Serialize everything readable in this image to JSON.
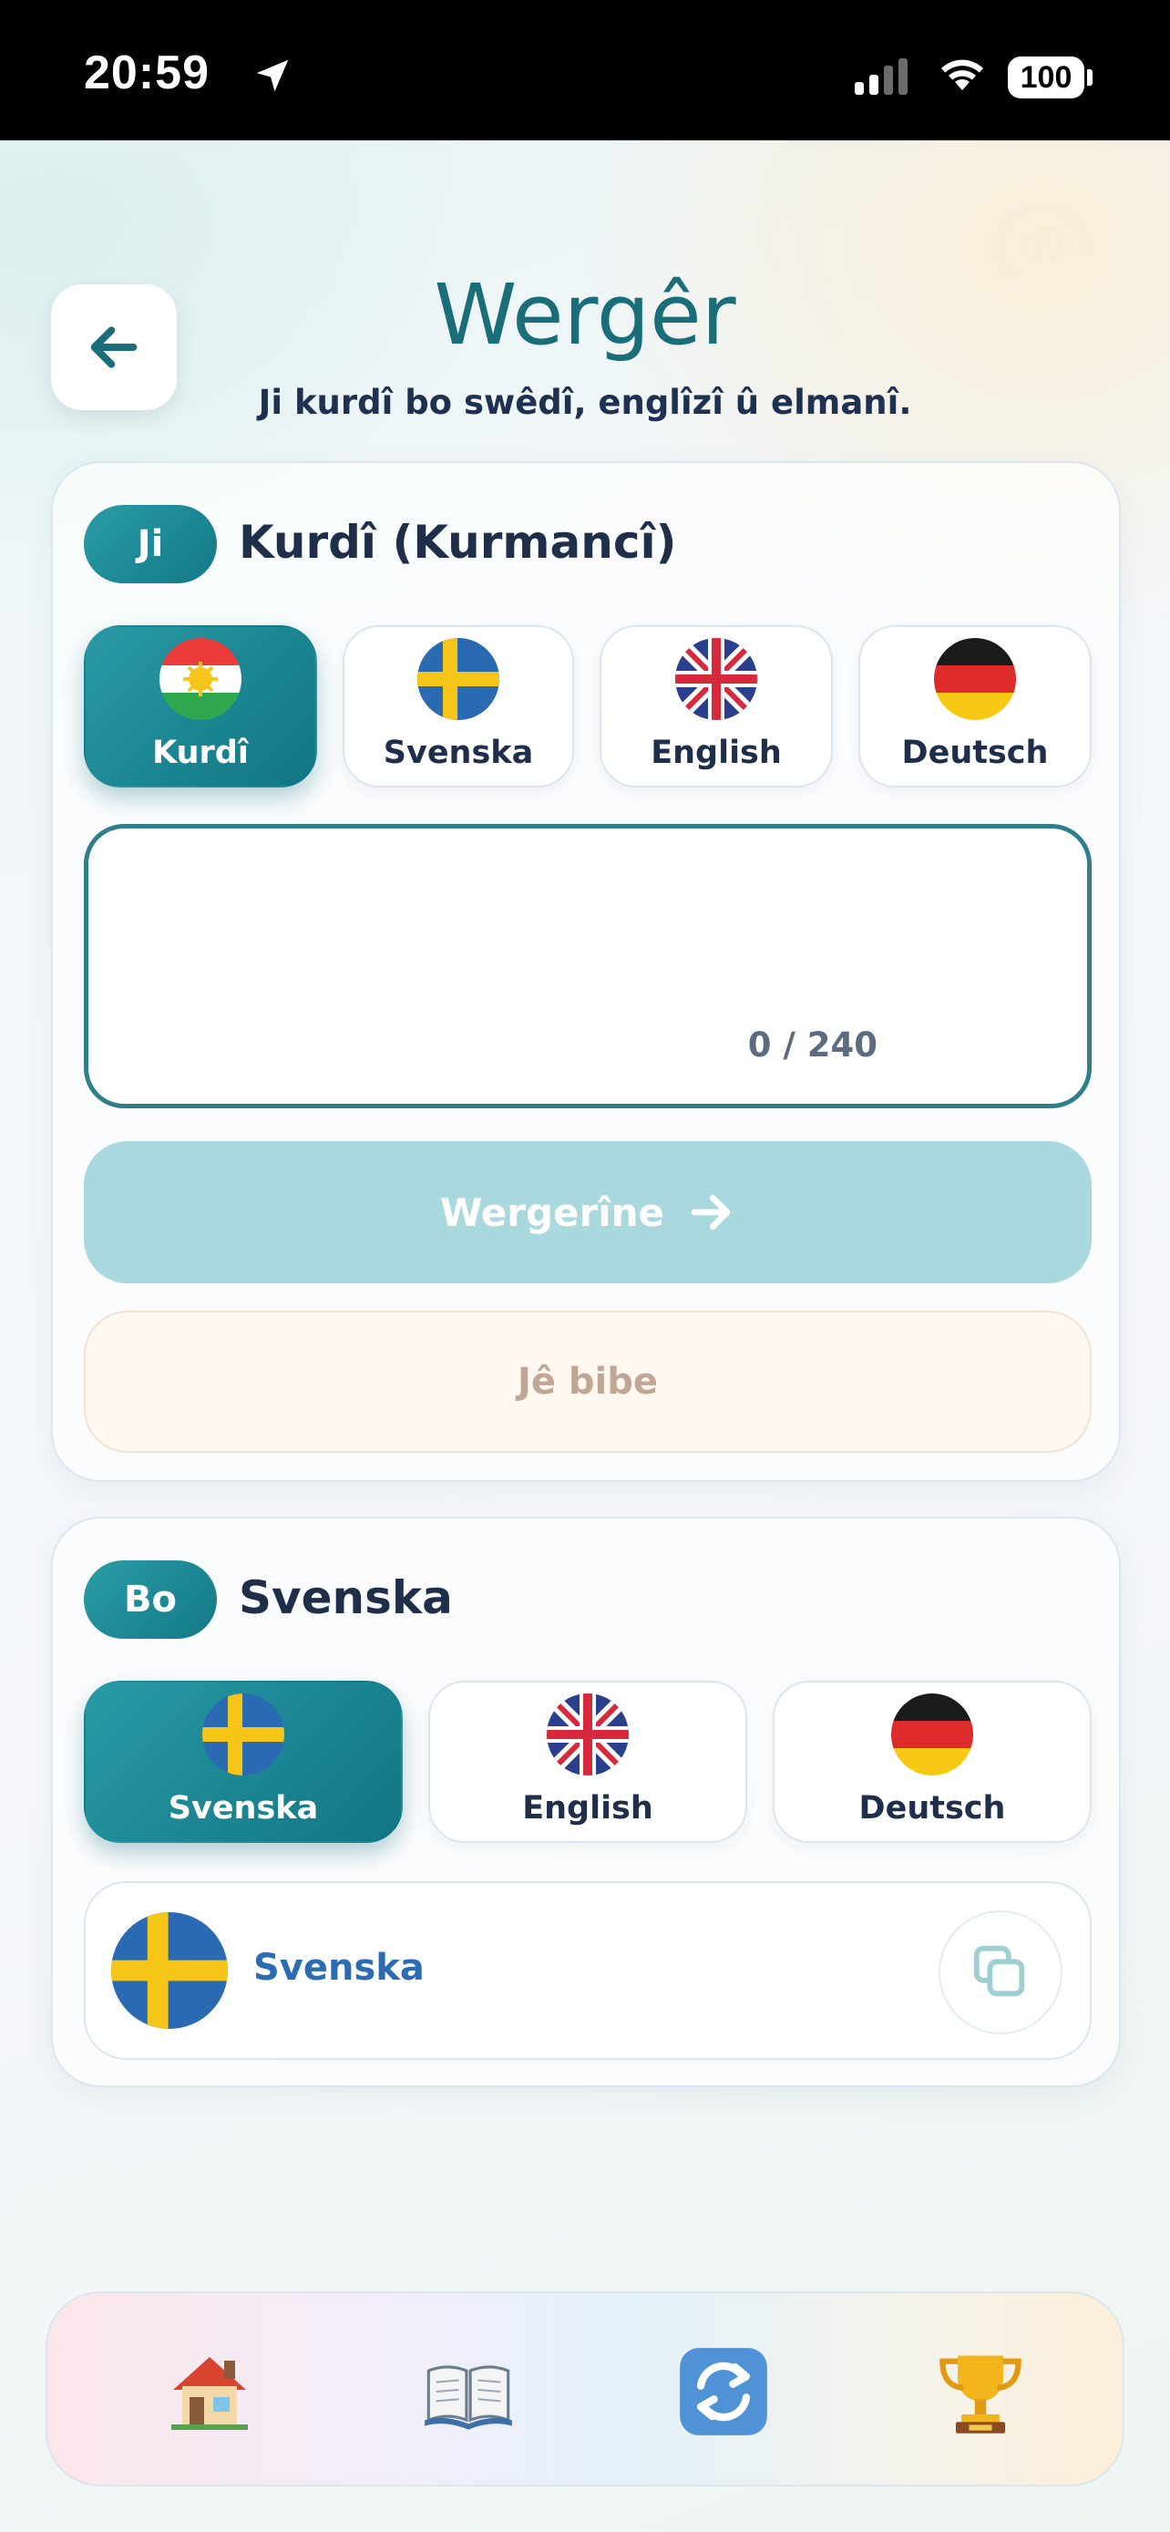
{
  "status_bar": {
    "time": "20:59",
    "battery": "100"
  },
  "header": {
    "title": "Wergêr",
    "subtitle": "Ji kurdî bo swêdî, englîzî û elmanî."
  },
  "source": {
    "pill": "Ji",
    "heading": "Kurdî (Kurmancî)",
    "languages": [
      {
        "label": "Kurdî",
        "flag": "kurdistan-flag",
        "active": true
      },
      {
        "label": "Svenska",
        "flag": "sweden-flag",
        "active": false
      },
      {
        "label": "English",
        "flag": "uk-flag",
        "active": false
      },
      {
        "label": "Deutsch",
        "flag": "germany-flag",
        "active": false
      }
    ],
    "input_value": "",
    "char_count": "0 / 240",
    "translate_label": "Wergerîne",
    "clear_label": "Jê bibe"
  },
  "target": {
    "pill": "Bo",
    "heading": "Svenska",
    "languages": [
      {
        "label": "Svenska",
        "flag": "sweden-flag",
        "active": true
      },
      {
        "label": "English",
        "flag": "uk-flag",
        "active": false
      },
      {
        "label": "Deutsch",
        "flag": "germany-flag",
        "active": false
      }
    ],
    "result_label": "Svenska"
  },
  "nav": [
    {
      "icon": "house-icon"
    },
    {
      "icon": "book-icon"
    },
    {
      "icon": "swap-icon",
      "active": true
    },
    {
      "icon": "trophy-icon"
    }
  ],
  "colors": {
    "accent": "#1a6e7a",
    "accent_button": "#137987",
    "translate_disabled": "#a9d9de",
    "clear_text": "#c0a694",
    "result_text": "#2b6cb4"
  }
}
